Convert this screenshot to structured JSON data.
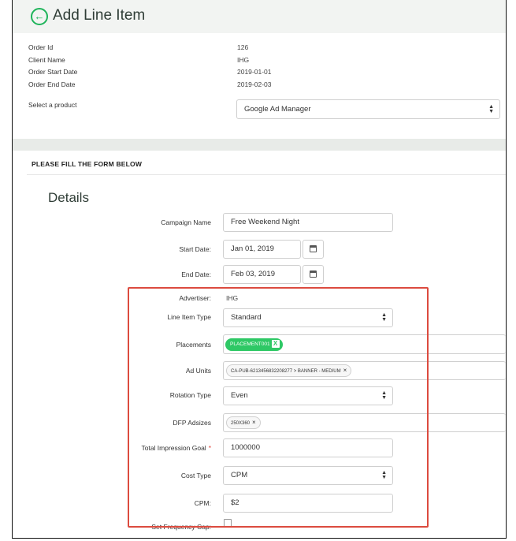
{
  "header": {
    "title": "Add Line Item",
    "back_icon": "arrow-left-circle-icon"
  },
  "order": {
    "items": [
      {
        "label": "Order Id",
        "value": "126"
      },
      {
        "label": "Client Name",
        "value": "IHG"
      },
      {
        "label": "Order Start Date",
        "value": "2019-01-01"
      },
      {
        "label": "Order End Date",
        "value": "2019-02-03"
      }
    ],
    "product_label": "Select a product",
    "product_value": "Google Ad Manager"
  },
  "form": {
    "heading": "PLEASE FILL THE FORM BELOW",
    "section_title": "Details",
    "campaign_name": {
      "label": "Campaign Name",
      "value": "Free Weekend Night"
    },
    "start_date": {
      "label": "Start Date:",
      "value": "Jan 01, 2019"
    },
    "end_date": {
      "label": "End Date:",
      "value": "Feb 03, 2019"
    },
    "advertiser": {
      "label": "Advertiser:",
      "value": "IHG"
    },
    "line_item_type": {
      "label": "Line Item Type",
      "value": "Standard"
    },
    "placements": {
      "label": "Placements",
      "tag": "PLACEMENT001",
      "remove": "X"
    },
    "ad_units": {
      "label": "Ad Units",
      "tag": "CA-PUB-6213456832208277 > BANNER - MEDIUM",
      "remove": "×"
    },
    "rotation_type": {
      "label": "Rotation Type",
      "value": "Even"
    },
    "dfp_adsizes": {
      "label": "DFP Adsizes",
      "tag": "250X360",
      "remove": "×"
    },
    "total_impression_goal": {
      "label": "Total Impression Goal",
      "required": "*",
      "value": "1000000"
    },
    "cost_type": {
      "label": "Cost Type",
      "value": "CPM"
    },
    "cpm": {
      "label": "CPM:",
      "value": "$2"
    },
    "set_frequency_cap": {
      "label": "Set Frequency Cap:"
    }
  },
  "colors": {
    "accent": "#2ec865",
    "highlight": "#dc4b3f",
    "title_bar": "#f2f4f2"
  }
}
